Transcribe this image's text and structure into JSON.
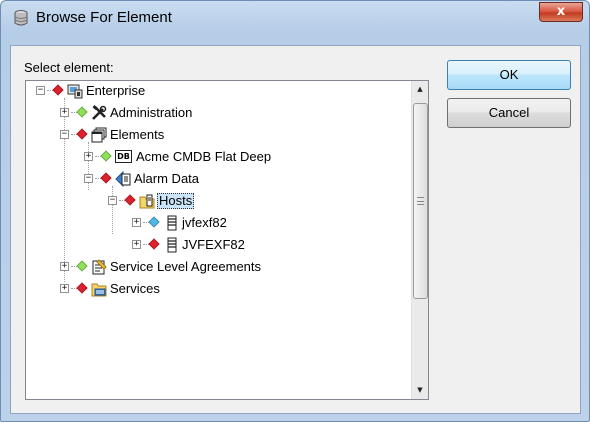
{
  "window": {
    "title": "Browse For Element",
    "close_glyph": "x"
  },
  "dialog": {
    "select_label": "Select element:",
    "ok_label": "OK",
    "cancel_label": "Cancel"
  },
  "tree": {
    "nodes": [
      {
        "label": "Enterprise",
        "expander": "−",
        "status": "red",
        "icon": "enterprise-icon"
      },
      {
        "label": "Administration",
        "expander": "+",
        "status": "green",
        "icon": "tools-icon"
      },
      {
        "label": "Elements",
        "expander": "−",
        "status": "red",
        "icon": "elements-icon"
      },
      {
        "label": "Acme CMDB Flat Deep",
        "expander": "+",
        "status": "green",
        "icon": "database-icon",
        "icon_text": "DB"
      },
      {
        "label": "Alarm Data",
        "expander": "−",
        "status": "red",
        "icon": "alarm-data-icon"
      },
      {
        "label": "Hosts",
        "expander": "−",
        "status": "red",
        "icon": "hosts-folder-icon",
        "selected": true
      },
      {
        "label": "jvfexf82",
        "expander": "+",
        "status": "blue",
        "icon": "server-icon"
      },
      {
        "label": "JVFEXF82",
        "expander": "+",
        "status": "red",
        "icon": "server-icon"
      },
      {
        "label": "Service Level Agreements",
        "expander": "+",
        "status": "green",
        "icon": "sla-icon"
      },
      {
        "label": "Services",
        "expander": "+",
        "status": "red",
        "icon": "services-icon"
      }
    ]
  },
  "scrollbar": {
    "up_glyph": "▲",
    "down_glyph": "▼"
  },
  "colors": {
    "status_red": "#e0202c",
    "status_green": "#8ee25a",
    "status_blue": "#4fb8e8",
    "selection": "#cce4f7"
  }
}
